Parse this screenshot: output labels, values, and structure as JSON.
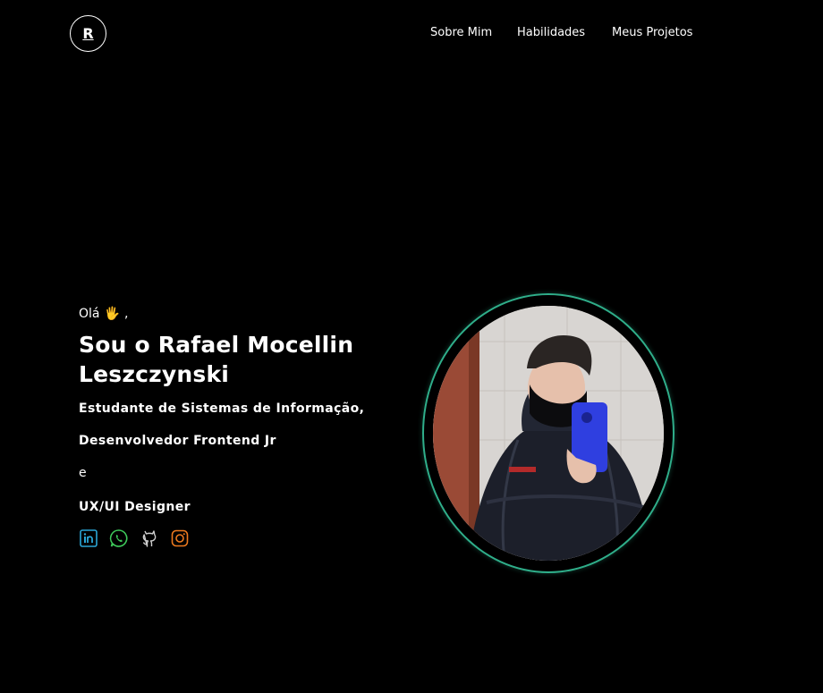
{
  "header": {
    "logo_letter": "R",
    "nav": [
      "Sobre Mim",
      "Habilidades",
      "Meus Projetos"
    ]
  },
  "hero": {
    "greeting": "Olá",
    "greeting_suffix": ",",
    "name": "Sou o Rafael Mocellin Leszczynski",
    "role_1": "Estudante de Sistemas de Informação,",
    "role_2": "Desenvolvedor Frontend Jr",
    "conjunction": "e",
    "role_3": "UX/UI Designer"
  },
  "socials": [
    {
      "icon": "linkedin-icon",
      "color": "#2aa6d6"
    },
    {
      "icon": "whatsapp-icon",
      "color": "#3ec95a"
    },
    {
      "icon": "github-icon",
      "color": "#cfcfcf"
    },
    {
      "icon": "instagram-icon",
      "color": "#ee7a1e"
    }
  ],
  "colors": {
    "background": "#000000",
    "text": "#ffffff",
    "ring": "#2fae8a"
  }
}
